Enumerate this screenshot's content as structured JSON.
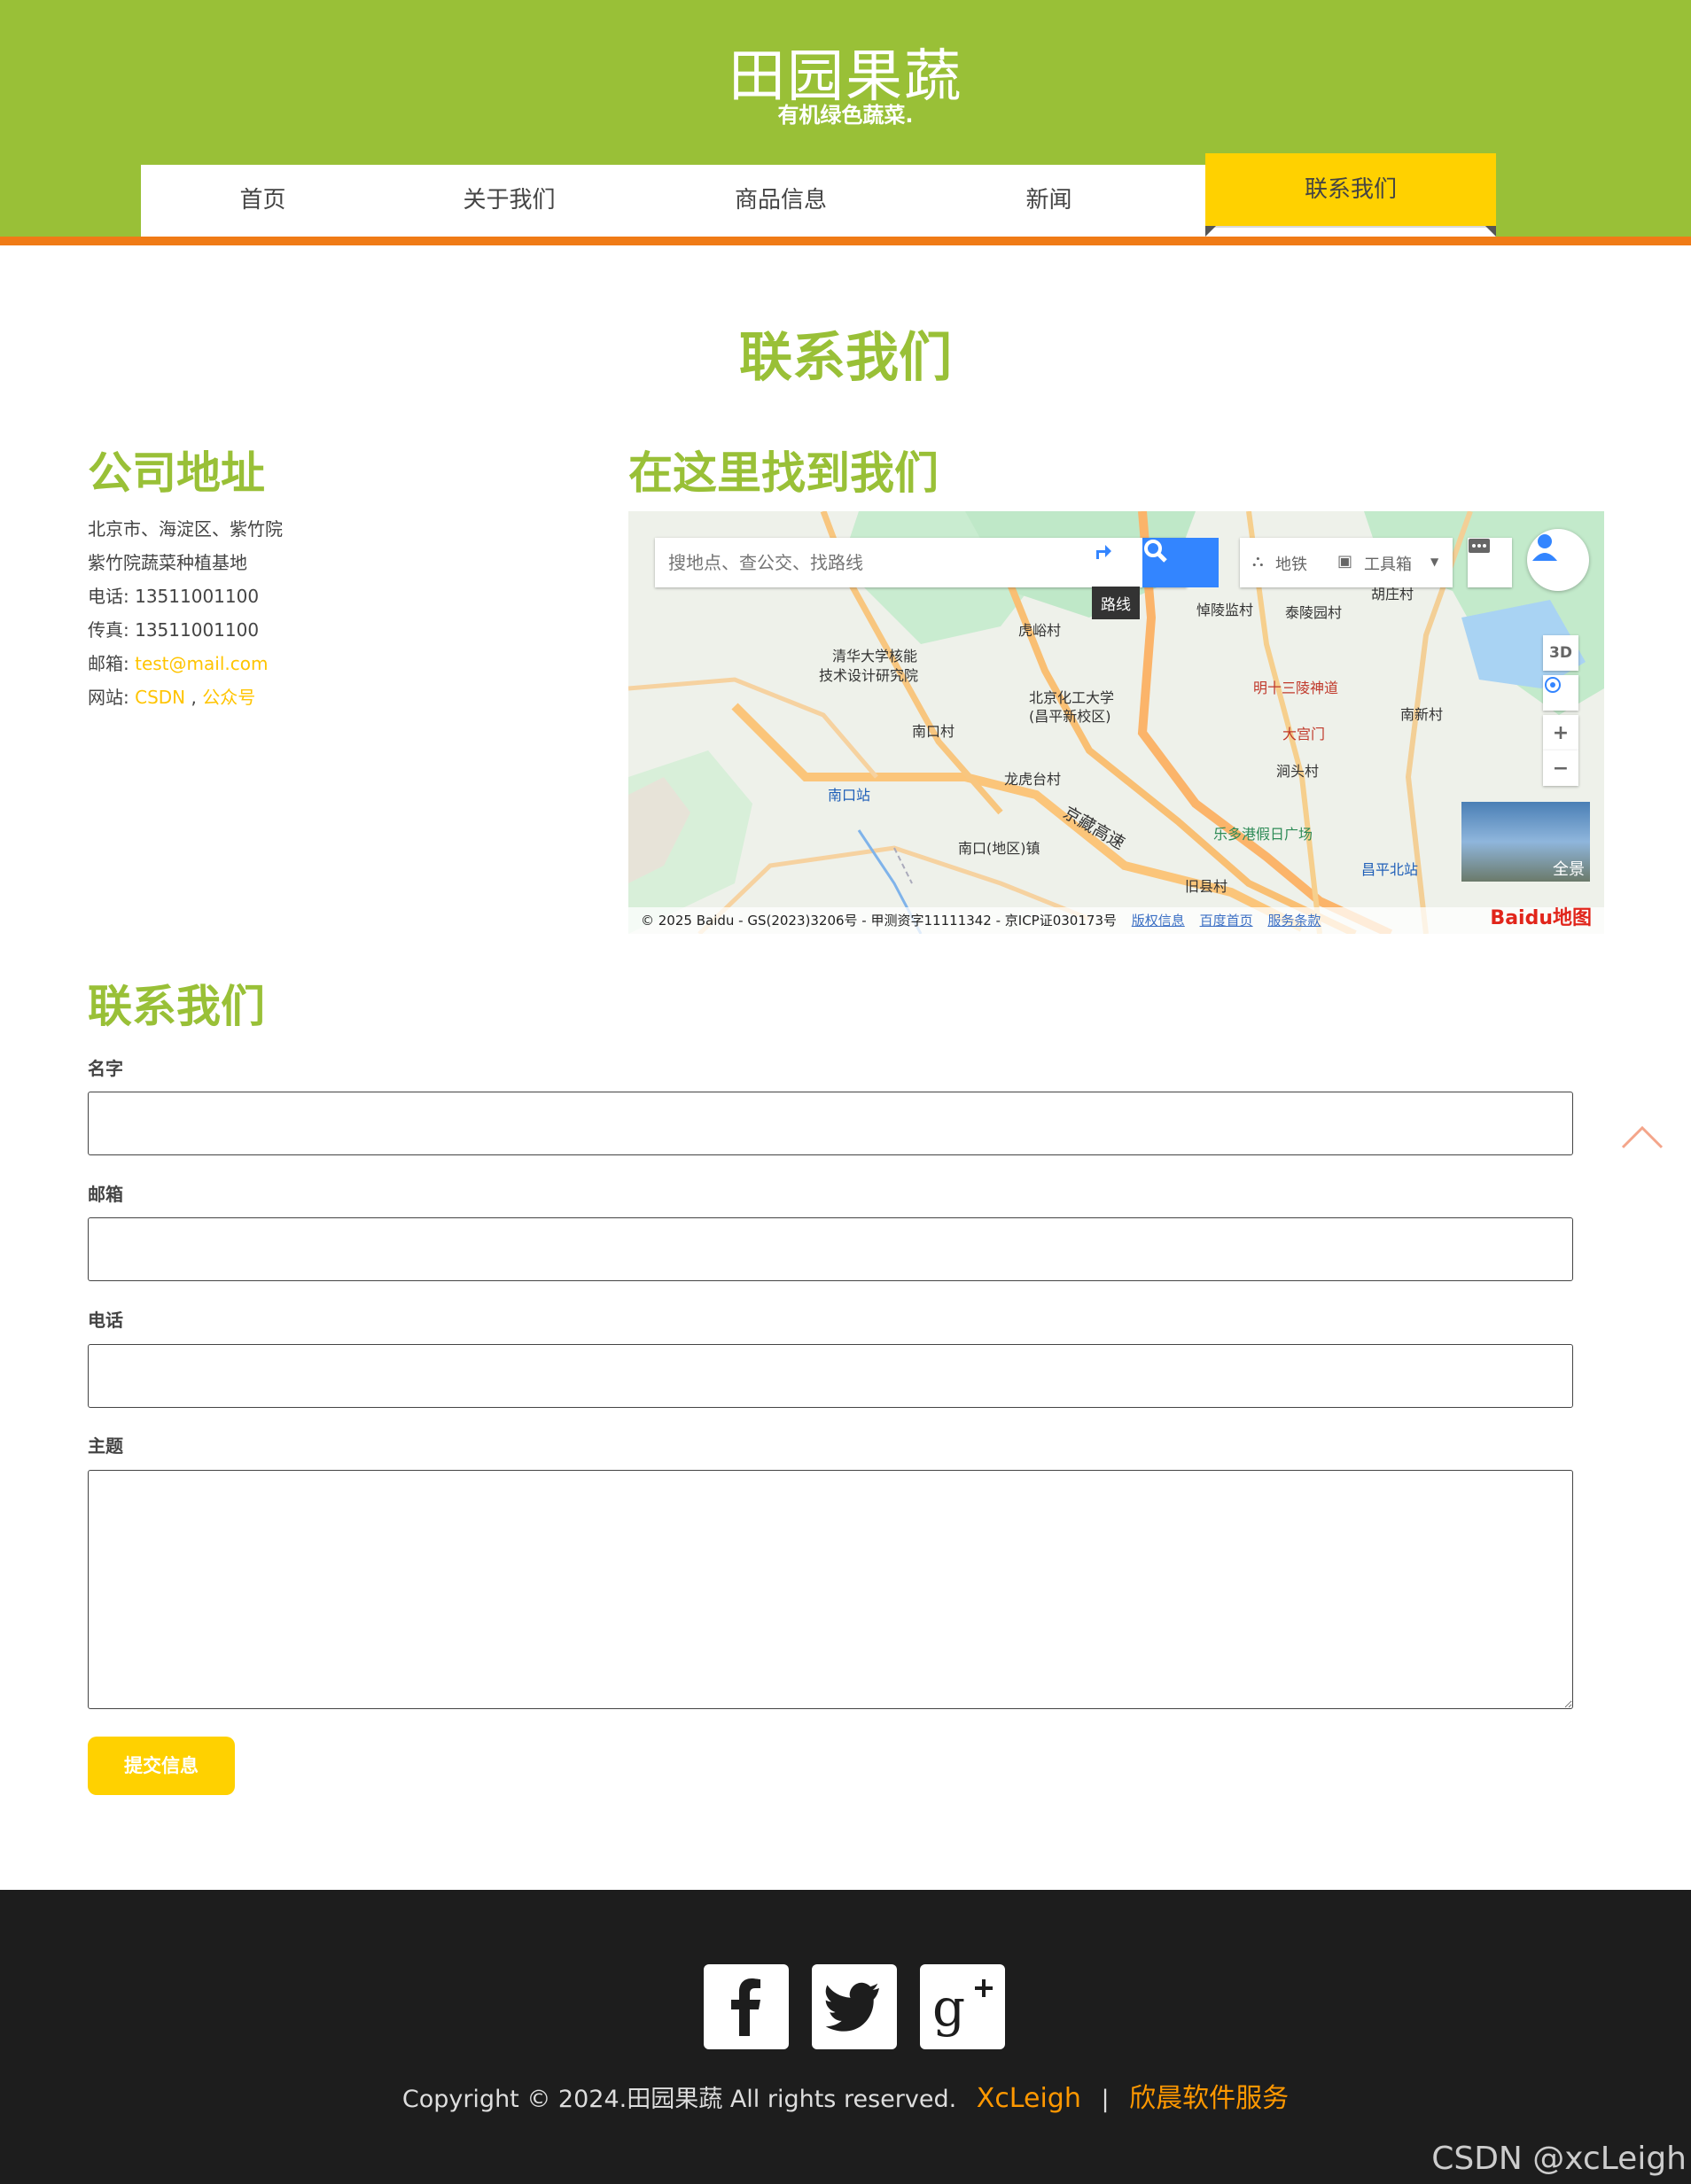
{
  "header": {
    "brand_title": "田园果蔬",
    "brand_subtitle": "有机绿色蔬菜.",
    "nav": [
      {
        "label": "首页"
      },
      {
        "label": "关于我们"
      },
      {
        "label": "商品信息"
      },
      {
        "label": "新闻"
      },
      {
        "label": "联系我们",
        "active": true
      }
    ]
  },
  "page_title": "联系我们",
  "address": {
    "heading": "公司地址",
    "line1": "北京市、海淀区、紫竹院",
    "line2": "紫竹院蔬菜种植基地",
    "phone_label": "电话: ",
    "phone": "13511001100",
    "fax_label": "传真: ",
    "fax": "13511001100",
    "email_label": "邮箱: ",
    "email": "test@mail.com",
    "site_label": "网站: ",
    "site_link1": "CSDN",
    "site_sep": " , ",
    "site_link2": "公众号"
  },
  "map": {
    "heading": "在这里找到我们",
    "search_placeholder": "搜地点、查公交、找路线",
    "route_tip": "路线",
    "subway_label": "地铁",
    "toolbox_label": "工具箱",
    "view_3d": "3D",
    "zoom_in": "+",
    "zoom_out": "−",
    "panorama_label": "全景",
    "copyright": "© 2025 Baidu - GS(2023)3206号 - 甲测资字11111342 - 京ICP证030173号",
    "links": [
      "版权信息",
      "百度首页",
      "服务条款"
    ],
    "logo": "Baidu地图",
    "places": [
      {
        "name": "清华大学核能"
      },
      {
        "name": "技术设计研究院"
      },
      {
        "name": "北京化工大学"
      },
      {
        "name": "(昌平新校区)"
      },
      {
        "name": "明十三陵神道"
      },
      {
        "name": "大宫门"
      },
      {
        "name": "南口站"
      },
      {
        "name": "南口(地区)镇"
      },
      {
        "name": "龙虎台村"
      },
      {
        "name": "南口村"
      },
      {
        "name": "虎峪村"
      },
      {
        "name": "悼陵监村"
      },
      {
        "name": "泰陵园村"
      },
      {
        "name": "胡庄村"
      },
      {
        "name": "南新村"
      },
      {
        "name": "涧头村"
      },
      {
        "name": "乐多港假日广场"
      },
      {
        "name": "昌平北站"
      },
      {
        "name": "旧县村"
      },
      {
        "name": "京藏高速"
      }
    ]
  },
  "form": {
    "heading": "联系我们",
    "name_label": "名字",
    "email_label": "邮箱",
    "phone_label": "电话",
    "subject_label": "主题",
    "submit_label": "提交信息"
  },
  "footer": {
    "social": [
      "facebook-icon",
      "twitter-icon",
      "google-plus-icon"
    ],
    "copyright": "Copyright © 2024.田园果蔬 All rights reserved.",
    "link1": "XcLeigh",
    "separator": "|",
    "link2": "欣晨软件服务",
    "watermark": "CSDN @xcLeigh"
  },
  "colors": {
    "brand_green": "#99c037",
    "accent_yellow": "#ffd100",
    "accent_orange": "#f07b16",
    "footer_bg": "#1d1d1d"
  }
}
